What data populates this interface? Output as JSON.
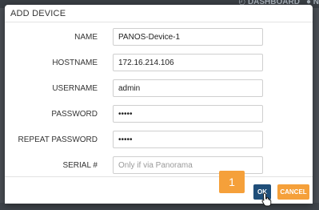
{
  "background": {
    "nav_dashboard": "DASHBOARD",
    "nav_partial": "N"
  },
  "dialog": {
    "title": "ADD DEVICE",
    "fields": [
      {
        "label": "NAME",
        "value": "PANOS-Device-1",
        "placeholder": "",
        "type": "text"
      },
      {
        "label": "HOSTNAME",
        "value": "172.16.214.106",
        "placeholder": "",
        "type": "text"
      },
      {
        "label": "USERNAME",
        "value": "admin",
        "placeholder": "",
        "type": "text"
      },
      {
        "label": "PASSWORD",
        "value": "•••••",
        "placeholder": "",
        "type": "password"
      },
      {
        "label": "REPEAT PASSWORD",
        "value": "•••••",
        "placeholder": "",
        "type": "password"
      },
      {
        "label": "SERIAL #",
        "value": "",
        "placeholder": "Only if via Panorama",
        "type": "text"
      }
    ],
    "step_badge": "1",
    "ok_label": "OK",
    "cancel_label": "CANCEL"
  },
  "colors": {
    "primary_button": "#1f4e79",
    "accent": "#f5a03a",
    "overlay": "#4a4f55"
  }
}
